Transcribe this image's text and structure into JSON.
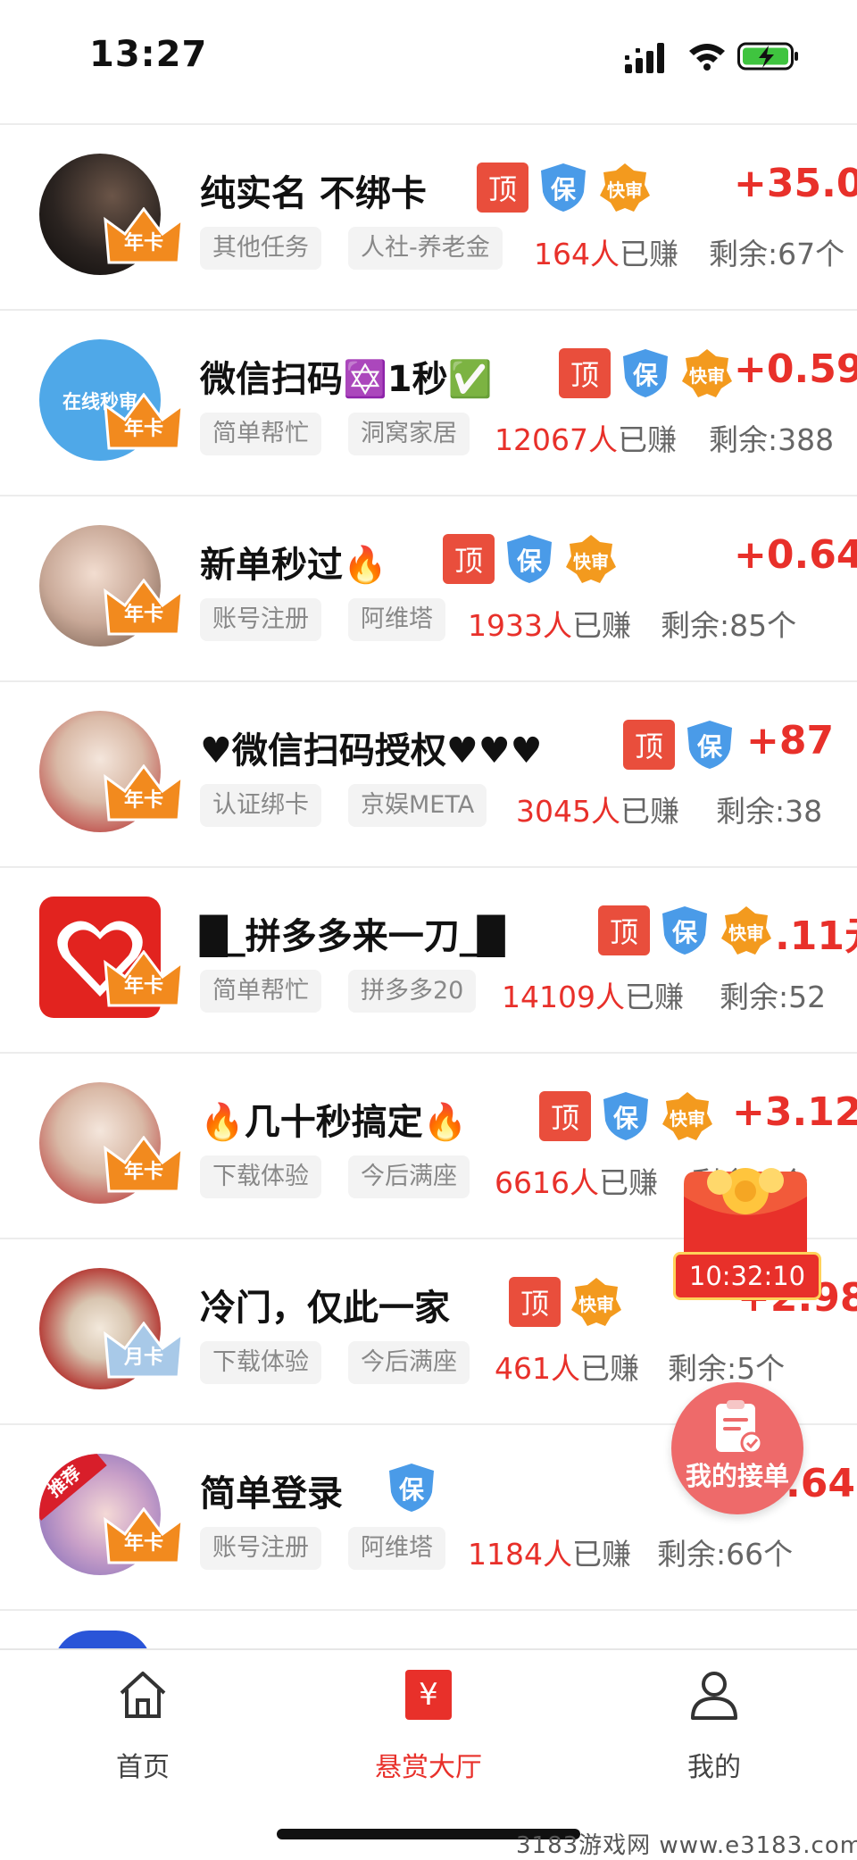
{
  "status_bar": {
    "time": "13:27"
  },
  "colors": {
    "accent": "#e8302a",
    "tag_bg": "#f3f3f3",
    "shield": "#4a9be8",
    "kuai": "#f39a1e"
  },
  "badges": {
    "ding": "顶",
    "bao": "保",
    "kuai": "快审"
  },
  "tasks": [
    {
      "title": "纯实名 不绑卡",
      "price": "+35.0",
      "tags": [
        "其他任务",
        "人社-养老金"
      ],
      "count": "164人",
      "earned": "已赚",
      "remaining": "剩余:67个",
      "crown": "年卡"
    },
    {
      "title": "微信扫码✡️1秒✅",
      "price": "+0.59",
      "tags": [
        "简单帮忙",
        "洞窝家居"
      ],
      "count": "12067人",
      "earned": "已赚",
      "remaining": "剩余:388",
      "crown": "年卡",
      "avatar_text": "在线秒审"
    },
    {
      "title": "新单秒过🔥",
      "price": "+0.64",
      "tags": [
        "账号注册",
        "阿维塔"
      ],
      "count": "1933人",
      "earned": "已赚",
      "remaining": "剩余:85个",
      "crown": "年卡"
    },
    {
      "title": "♥微信扫码授权♥♥♥",
      "price": "+87",
      "tags": [
        "认证绑卡",
        "京娱META"
      ],
      "count": "3045人",
      "earned": "已赚",
      "remaining": "剩余:38",
      "crown": "年卡"
    },
    {
      "title": "█_拼多多来一刀_█",
      "price": ".11元",
      "tags": [
        "简单帮忙",
        "拼多多20"
      ],
      "count": "14109人",
      "earned": "已赚",
      "remaining": "剩余:52",
      "crown": "年卡"
    },
    {
      "title": "🔥几十秒搞定🔥",
      "price": "+3.12",
      "tags": [
        "下载体验",
        "今后满座"
      ],
      "count": "6616人",
      "earned": "已赚",
      "remaining": "剩余:4个",
      "crown": "年卡"
    },
    {
      "title": "冷门，仅此一家",
      "price": "+2.98",
      "tags": [
        "下载体验",
        "今后满座"
      ],
      "count": "461人",
      "earned": "已赚",
      "remaining": "剩余:5个",
      "crown": "月卡"
    },
    {
      "title": "简单登录",
      "price": ".64",
      "tags": [
        "账号注册",
        "阿维塔"
      ],
      "count": "1184人",
      "earned": "已赚",
      "remaining": "剩余:66个",
      "crown": "年卡",
      "ribbon": "推荐"
    }
  ],
  "floating": {
    "timer": "10:32:10",
    "my_orders": "我的接单"
  },
  "tabbar": {
    "home": "首页",
    "hall": "悬赏大厅",
    "hall_icon_glyph": "¥",
    "mine": "我的"
  },
  "watermark": "3183游戏网 www.e3183.com"
}
